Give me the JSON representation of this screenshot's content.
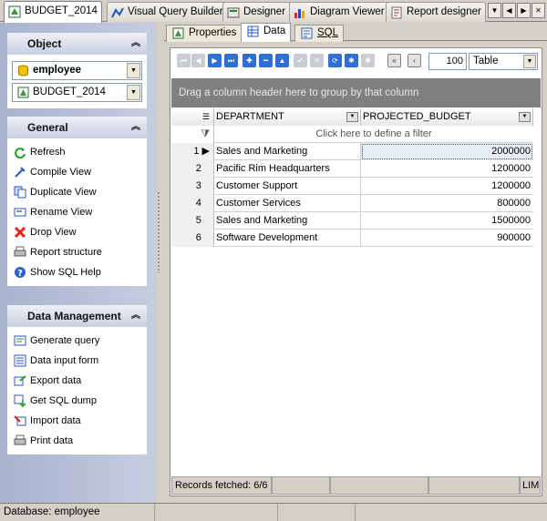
{
  "doc_tabs": [
    {
      "label": "BUDGET_2014",
      "icon": "table-icon",
      "active": true
    },
    {
      "label": "Visual Query Builder",
      "icon": "query-builder-icon"
    },
    {
      "label": "Designer",
      "icon": "designer-icon"
    },
    {
      "label": "Diagram Viewer",
      "icon": "diagram-icon"
    },
    {
      "label": "Report designer",
      "icon": "report-icon"
    }
  ],
  "nav_glyphs": {
    "menu": "▼",
    "prev": "◀",
    "next": "▶",
    "close": "✕"
  },
  "object_group": {
    "title": "Object",
    "database_value": "employee",
    "object_value": "BUDGET_2014"
  },
  "general_group": {
    "title": "General",
    "items": [
      {
        "label": "Refresh",
        "icon": "refresh-icon"
      },
      {
        "label": "Compile View",
        "icon": "compile-icon"
      },
      {
        "label": "Duplicate View",
        "icon": "duplicate-icon"
      },
      {
        "label": "Rename View",
        "icon": "rename-icon"
      },
      {
        "label": "Drop View",
        "icon": "drop-icon"
      },
      {
        "label": "Report structure",
        "icon": "printer-icon"
      },
      {
        "label": "Show SQL Help",
        "icon": "help-icon"
      }
    ]
  },
  "data_group": {
    "title": "Data Management",
    "items": [
      {
        "label": "Generate query",
        "icon": "generate-query-icon"
      },
      {
        "label": "Data input form",
        "icon": "form-icon"
      },
      {
        "label": "Export data",
        "icon": "export-icon"
      },
      {
        "label": "Get SQL dump",
        "icon": "dump-icon"
      },
      {
        "label": "Import data",
        "icon": "import-icon"
      },
      {
        "label": "Print data",
        "icon": "printer-icon"
      }
    ]
  },
  "sub_tabs": [
    {
      "label": "Properties",
      "icon": "properties-icon"
    },
    {
      "label": "Data",
      "icon": "grid-icon",
      "active": true
    },
    {
      "label": "SQL",
      "icon": "sql-icon"
    }
  ],
  "toolbar": {
    "limit_value": "100",
    "view_mode": "Table"
  },
  "group_panel_text": "Drag a column header here to group by that column",
  "grid": {
    "columns": [
      "DEPARTMENT",
      "PROJECTED_BUDGET"
    ],
    "filter_text": "Click here to define a filter",
    "rows": [
      {
        "num": "1",
        "department": "Sales and Marketing",
        "budget": "2000000"
      },
      {
        "num": "2",
        "department": "Pacific Rim Headquarters",
        "budget": "1200000"
      },
      {
        "num": "3",
        "department": "Customer Support",
        "budget": "1200000"
      },
      {
        "num": "4",
        "department": "Customer Services",
        "budget": "800000"
      },
      {
        "num": "5",
        "department": "Sales and Marketing",
        "budget": "1500000"
      },
      {
        "num": "6",
        "department": "Software Development",
        "budget": "900000"
      }
    ]
  },
  "status": {
    "records": "Records fetched: 6/6",
    "limit_flag": "LIM"
  },
  "app_status": {
    "database": "Database: employee"
  }
}
